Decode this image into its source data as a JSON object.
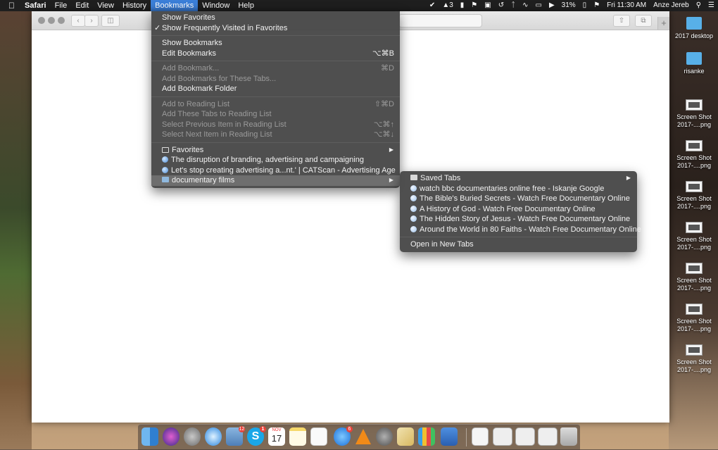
{
  "menubar": {
    "app": "Safari",
    "items": [
      "File",
      "Edit",
      "View",
      "History",
      "Bookmarks",
      "Window",
      "Help"
    ],
    "active": "Bookmarks",
    "status": {
      "notification_count": "3",
      "battery": "31%",
      "clock": "Fri 11:30 AM",
      "user": "Anze Jereb"
    }
  },
  "bookmarks_menu": {
    "show_favorites": "Show Favorites",
    "show_frequently_visited": "Show Frequently Visited in Favorites",
    "show_bookmarks": "Show Bookmarks",
    "edit_bookmarks": "Edit Bookmarks",
    "edit_bookmarks_shortcut": "⌥⌘B",
    "add_bookmark": "Add Bookmark...",
    "add_bookmark_shortcut": "⌘D",
    "add_bookmarks_tabs": "Add Bookmarks for These Tabs...",
    "add_bookmark_folder": "Add Bookmark Folder",
    "add_reading_list": "Add to Reading List",
    "add_reading_list_shortcut": "⇧⌘D",
    "add_tabs_reading_list": "Add These Tabs to Reading List",
    "select_prev_reading": "Select Previous Item in Reading List",
    "select_prev_shortcut": "⌥⌘↑",
    "select_next_reading": "Select Next Item in Reading List",
    "select_next_shortcut": "⌥⌘↓",
    "favorites": "Favorites",
    "bookmark_1": "The disruption of branding, advertising and campaigning",
    "bookmark_2": "Let's stop creating advertising a...nt.' | CATScan - Advertising Age",
    "folder": "documentary films"
  },
  "submenu": {
    "saved_tabs": "Saved Tabs",
    "items": [
      "watch bbc documentaries online free - Iskanje Google",
      "The Bible's Buried Secrets - Watch Free Documentary Online",
      "A History of God - Watch Free Documentary Online",
      "The Hidden Story of Jesus - Watch Free Documentary Online",
      "Around the World in 80 Faiths - Watch Free Documentary Online"
    ],
    "open_new_tabs": "Open in New Tabs"
  },
  "desktop": {
    "items": [
      {
        "label": "2017 desktop"
      },
      {
        "label": "risanke"
      },
      {
        "label1": "Screen Shot",
        "label2": "2017-....png"
      },
      {
        "label1": "Screen Shot",
        "label2": "2017-....png"
      },
      {
        "label1": "Screen Shot",
        "label2": "2017-....png"
      },
      {
        "label1": "Screen Shot",
        "label2": "2017-....png"
      },
      {
        "label1": "Screen Shot",
        "label2": "2017-....png"
      },
      {
        "label1": "Screen Shot",
        "label2": "2017-....png"
      },
      {
        "label1": "Screen Shot",
        "label2": "2017-....png"
      }
    ]
  },
  "dock": {
    "mail_badge": "12",
    "skype_badge": "1",
    "calendar_month": "NOV",
    "calendar_day": "17",
    "appstore_badge": "6"
  }
}
